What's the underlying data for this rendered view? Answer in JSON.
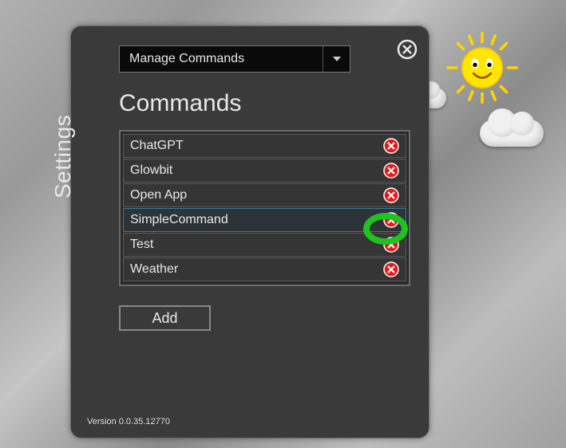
{
  "sidebar": {
    "title": "Settings"
  },
  "dropdown": {
    "selected": "Manage Commands"
  },
  "heading": "Commands",
  "commands": [
    {
      "label": "ChatGPT",
      "selected": false
    },
    {
      "label": "Glowbit",
      "selected": false
    },
    {
      "label": "Open App",
      "selected": false
    },
    {
      "label": "SimpleCommand",
      "selected": true
    },
    {
      "label": "Test",
      "selected": false
    },
    {
      "label": "Weather",
      "selected": false
    }
  ],
  "buttons": {
    "add": "Add"
  },
  "version": "Version 0.0.35.12770",
  "highlight_target_index": 3
}
